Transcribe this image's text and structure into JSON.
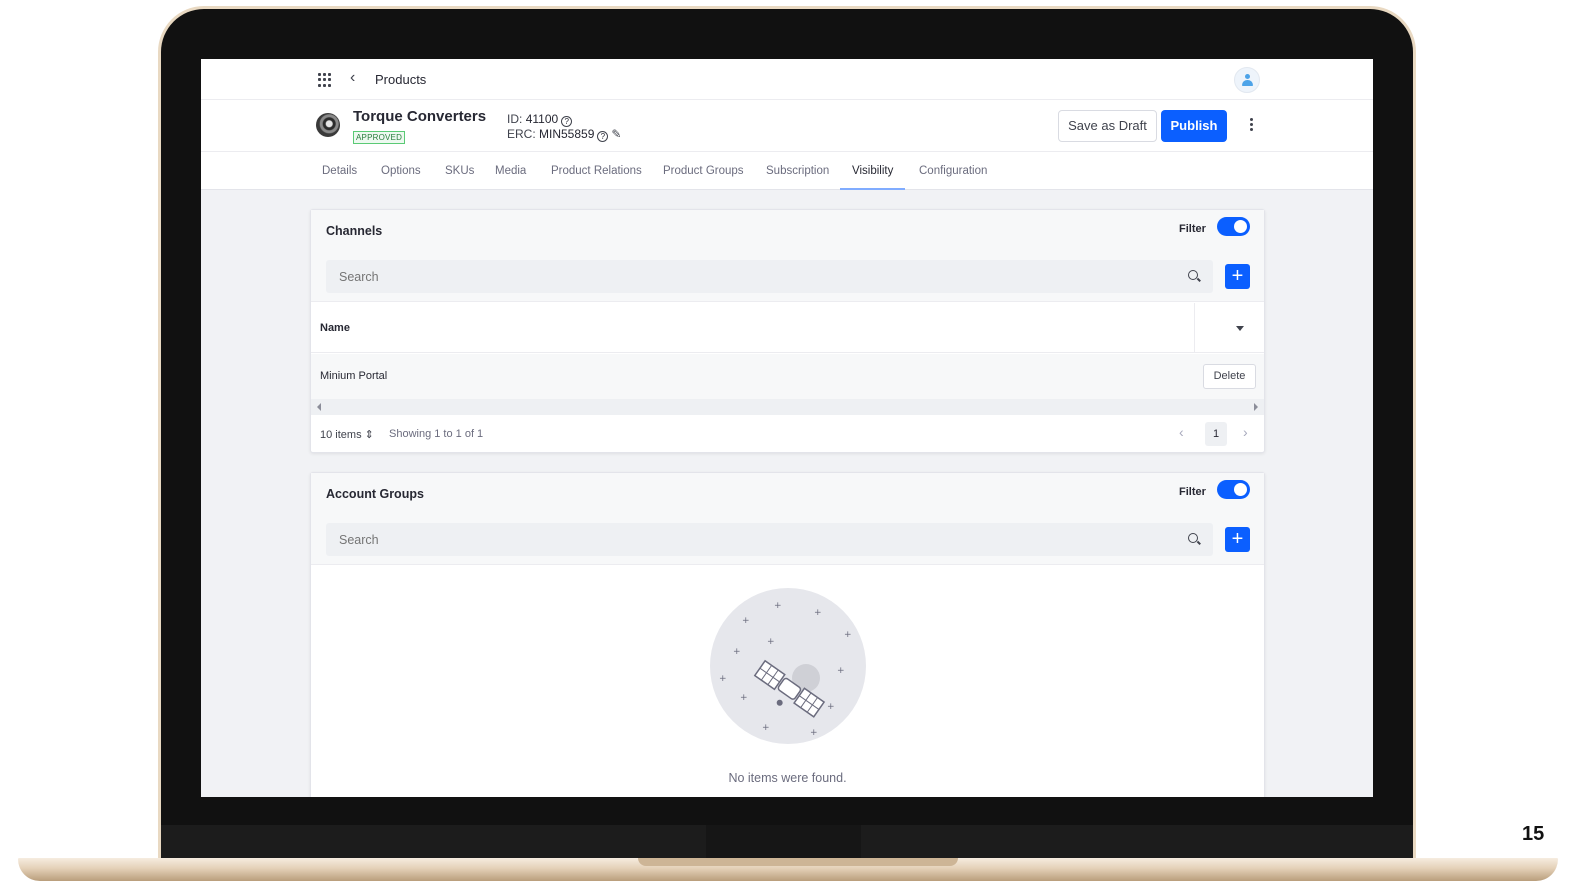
{
  "topbar": {
    "title": "Products"
  },
  "product": {
    "name": "Torque Converters",
    "status": "APPROVED",
    "id_label": "ID:",
    "id_value": "41100",
    "erc_label": "ERC:",
    "erc_value": "MIN55859"
  },
  "actions": {
    "save_draft": "Save as Draft",
    "publish": "Publish"
  },
  "tabs": [
    {
      "label": "Details"
    },
    {
      "label": "Options"
    },
    {
      "label": "SKUs"
    },
    {
      "label": "Media"
    },
    {
      "label": "Product Relations"
    },
    {
      "label": "Product Groups"
    },
    {
      "label": "Subscription"
    },
    {
      "label": "Visibility",
      "active": true
    },
    {
      "label": "Configuration"
    }
  ],
  "channels": {
    "title": "Channels",
    "filter_label": "Filter",
    "filter_on": true,
    "search_placeholder": "Search",
    "column_name": "Name",
    "rows": [
      {
        "name": "Minium Portal",
        "action": "Delete"
      }
    ],
    "items_per_page": "10 items",
    "showing": "Showing 1 to 1 of 1",
    "current_page": "1"
  },
  "account_groups": {
    "title": "Account Groups",
    "filter_label": "Filter",
    "filter_on": true,
    "search_placeholder": "Search",
    "empty_message": "No items were found."
  },
  "slide_number": "15",
  "colors": {
    "primary": "#0b5fff",
    "approved": "#287d3c",
    "tab_indicator": "#80acff"
  }
}
